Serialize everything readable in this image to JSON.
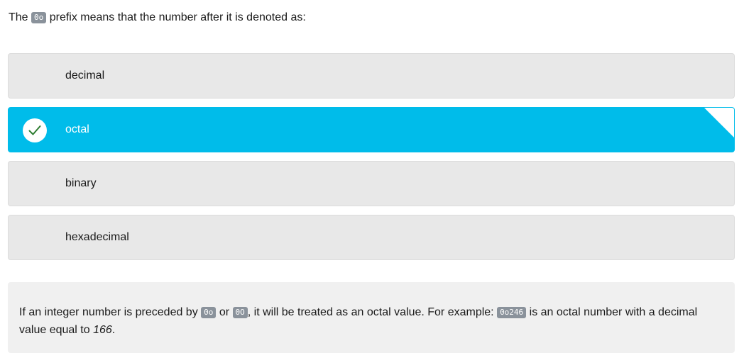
{
  "question": {
    "text_before": "The ",
    "code": "0o",
    "text_after": " prefix means that the number after it is denoted as:"
  },
  "options": [
    {
      "label": "decimal",
      "selected": false
    },
    {
      "label": "octal",
      "selected": true
    },
    {
      "label": "binary",
      "selected": false
    },
    {
      "label": "hexadecimal",
      "selected": false
    }
  ],
  "explanation": {
    "part1": "If an integer number is preceded by ",
    "code1": "0o",
    "part2": " or ",
    "code2": "0O",
    "part3": ", it will be treated as an octal value. For example: ",
    "code3": "0o246",
    "part4": " is an octal number with a decimal value equal to ",
    "value": "166",
    "part5": "."
  },
  "colors": {
    "selected_bg": "#00bcea",
    "option_bg": "#e8e8e8",
    "check_green": "#2e7d32"
  }
}
